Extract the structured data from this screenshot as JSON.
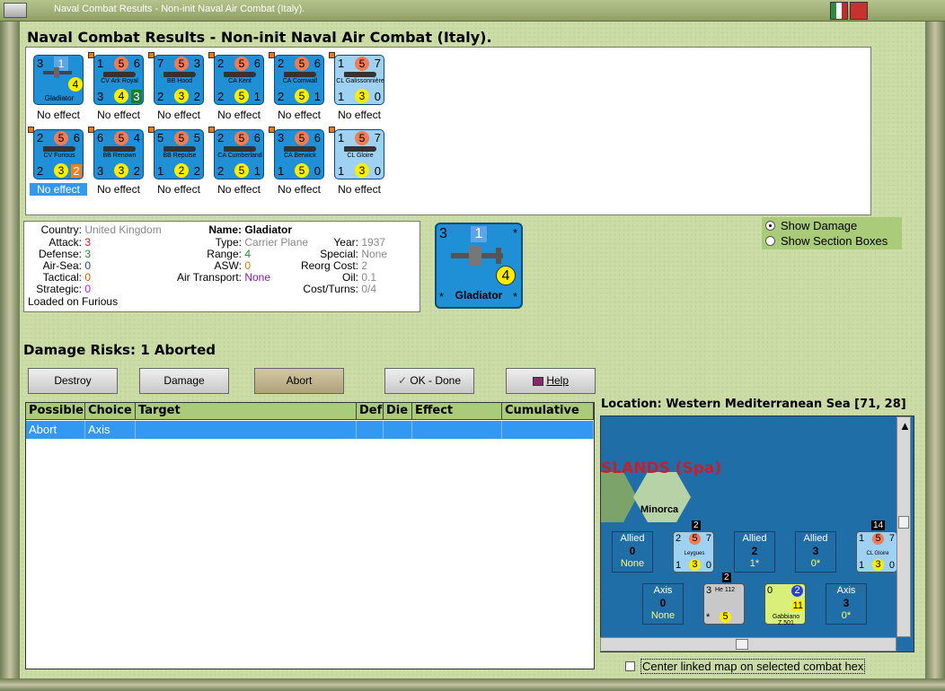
{
  "window": {
    "title": "Naval Combat Results - Non-init Naval Air Combat (Italy)."
  },
  "header": {
    "title": "Naval Combat Results - Non-init Naval Air Combat (Italy)."
  },
  "units_row1": [
    {
      "a": "3",
      "b": "1",
      "c": "",
      "d": "",
      "e": "4",
      "f": "",
      "name": "Gladiator",
      "effect": "No effect"
    },
    {
      "a": "1",
      "b": "5",
      "c": "6",
      "d": "3",
      "e": "4",
      "f": "3",
      "name": "CV Ark Royal",
      "effect": "No effect"
    },
    {
      "a": "7",
      "b": "5",
      "c": "3",
      "d": "2",
      "e": "3",
      "f": "2",
      "name": "BB Hood",
      "effect": "No effect"
    },
    {
      "a": "2",
      "b": "5",
      "c": "6",
      "d": "2",
      "e": "5",
      "f": "1",
      "name": "CA Kent",
      "effect": "No effect"
    },
    {
      "a": "2",
      "b": "5",
      "c": "6",
      "d": "2",
      "e": "5",
      "f": "1",
      "name": "CA Cornwall",
      "effect": "No effect"
    },
    {
      "a": "1",
      "b": "5",
      "c": "7",
      "d": "1",
      "e": "3",
      "f": "0",
      "name": "CL Galissonnière",
      "effect": "No effect"
    }
  ],
  "units_row2": [
    {
      "a": "2",
      "b": "5",
      "c": "6",
      "d": "2",
      "e": "3",
      "f": "2",
      "name": "CV Furious",
      "effect": "No effect"
    },
    {
      "a": "6",
      "b": "5",
      "c": "4",
      "d": "3",
      "e": "3",
      "f": "2",
      "name": "BB Renown",
      "effect": "No effect"
    },
    {
      "a": "5",
      "b": "5",
      "c": "5",
      "d": "1",
      "e": "2",
      "f": "2",
      "name": "BB Repulse",
      "effect": "No effect"
    },
    {
      "a": "2",
      "b": "5",
      "c": "6",
      "d": "2",
      "e": "5",
      "f": "1",
      "name": "CA Cumberland",
      "effect": "No effect"
    },
    {
      "a": "3",
      "b": "5",
      "c": "6",
      "d": "1",
      "e": "5",
      "f": "0",
      "name": "CA Berwick",
      "effect": "No effect"
    },
    {
      "a": "1",
      "b": "5",
      "c": "7",
      "d": "1",
      "e": "3",
      "f": "0",
      "name": "CL Gloire",
      "effect": "No effect"
    }
  ],
  "info": {
    "country_label": "Country:",
    "country": "United Kingdom",
    "attack_label": "Attack:",
    "attack": "3",
    "defense_label": "Defense:",
    "defense": "3",
    "airsea_label": "Air-Sea:",
    "airsea": "0",
    "tactical_label": "Tactical:",
    "tactical": "0",
    "strategic_label": "Strategic:",
    "strategic": "0",
    "loaded": "Loaded on Furious",
    "name_label": "Name:",
    "name": "Gladiator",
    "type_label": "Type:",
    "type": "Carrier Plane",
    "range_label": "Range:",
    "range": "4",
    "asw_label": "ASW:",
    "asw": "0",
    "airtransport_label": "Air Transport:",
    "airtransport": "None",
    "year_label": "Year:",
    "year": "1937",
    "special_label": "Special:",
    "special": "None",
    "reorg_label": "Reorg Cost:",
    "reorg": "2",
    "oil_label": "Oil:",
    "oil": "0.1",
    "costturns_label": "Cost/Turns:",
    "costturns": "0/4"
  },
  "big_counter": {
    "tl": "3",
    "tc": "1",
    "tr": "*",
    "br_val": "4",
    "bl": "*",
    "brs": "*",
    "name": "Gladiator"
  },
  "options": {
    "show_damage": "Show Damage",
    "show_sections": "Show Section Boxes"
  },
  "damage": {
    "title": "Damage Risks:  1 Aborted"
  },
  "buttons": {
    "destroy": "Destroy",
    "damage": "Damage",
    "abort": "Abort",
    "ok": "OK - Done",
    "help": "Help"
  },
  "table": {
    "headers": [
      "Possible",
      "Choice",
      "Target",
      "Def",
      "Die",
      "Effect",
      "Cumulative"
    ],
    "rows": [
      [
        "Abort",
        "Axis",
        "",
        "",
        "",
        "",
        ""
      ]
    ]
  },
  "location": {
    "label": "Location:  Western Mediterranean Sea [71, 28]",
    "island": "SLANDS (Spa)",
    "hex_name": "Minorca",
    "allied_boxes": [
      {
        "side": "Allied",
        "n": "0",
        "v": "None"
      },
      {
        "side": "Allied",
        "n": "2",
        "v": "1*"
      },
      {
        "side": "Allied",
        "n": "3",
        "v": "0*"
      }
    ],
    "axis_boxes": [
      {
        "side": "Axis",
        "n": "0",
        "v": "None"
      },
      {
        "side": "Axis",
        "n": "3",
        "v": "0*"
      }
    ],
    "counters": [
      {
        "stack": "2",
        "a": "2",
        "b": "5",
        "c": "7",
        "d": "1",
        "e": "3",
        "f": "0",
        "name": "Leygues"
      },
      {
        "stack": "14",
        "a": "1",
        "b": "5",
        "c": "7",
        "d": "1",
        "e": "3",
        "f": "0",
        "name": "CL Gloire"
      },
      {
        "stack": "2",
        "a": "3",
        "b": "",
        "c": "",
        "d": "*",
        "e": "5",
        "f": "",
        "name": "He 112"
      },
      {
        "stack": "",
        "a": "0",
        "b": "2",
        "c": "",
        "d": "",
        "e": "11",
        "f": "",
        "name": "Gabbiano Z.501"
      }
    ]
  },
  "footer": {
    "center_map": "Center linked map on selected combat hex"
  },
  "colors": {
    "counter_blue": "#1f8fd6",
    "counter_light": "#9fd2f2",
    "selection": "#3398f0",
    "header_green": "#aacb79"
  }
}
